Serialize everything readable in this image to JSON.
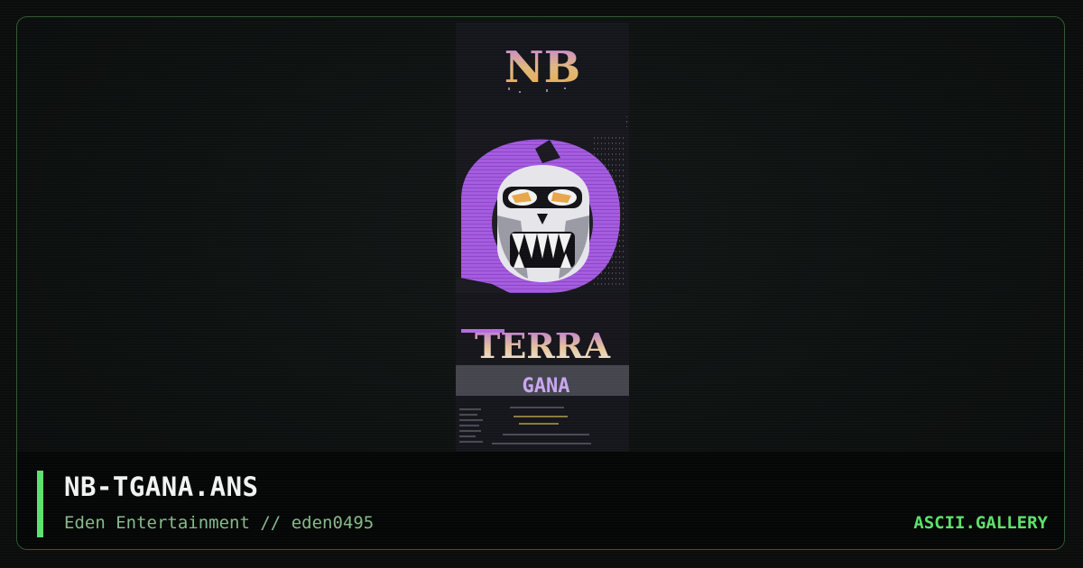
{
  "artwork": {
    "filename": "NB-TGANA.ANS",
    "group": "Eden Entertainment",
    "separator": "//",
    "author": "eden0495",
    "logo_text": "NB",
    "lower_logo_text": "TERRA",
    "lower_logo_subtext": "GANA"
  },
  "site": {
    "name": "ASCII.GALLERY"
  },
  "icons": {
    "artwork": "skull-ansi-art"
  },
  "colors": {
    "accent": "#5ee06a",
    "subtitle": "#86b98a",
    "title": "#f2f2f2",
    "frame_border": "#2f5a33",
    "art_purple": "#a55be0",
    "art_orange": "#e8a64a"
  }
}
